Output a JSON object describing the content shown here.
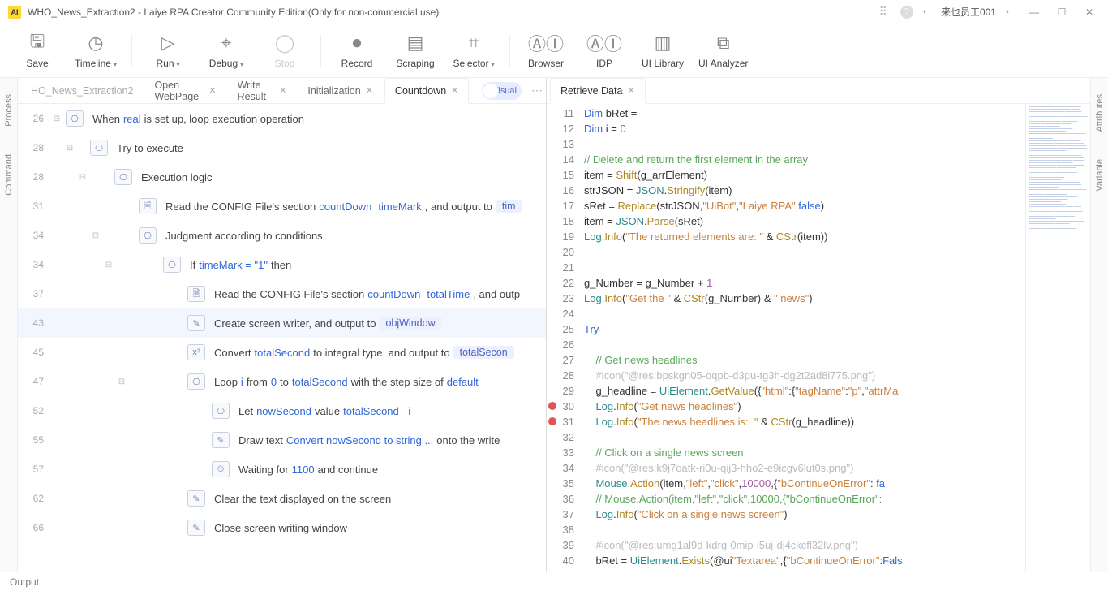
{
  "titlebar": {
    "title": "WHO_News_Extraction2 - Laiye RPA Creator Community Edition(Only for non-commercial use)",
    "user": "来也员工001"
  },
  "toolbar": {
    "save": "Save",
    "timeline": "Timeline",
    "run": "Run",
    "debug": "Debug",
    "stop": "Stop",
    "record": "Record",
    "scraping": "Scraping",
    "selector": "Selector",
    "browser": "Browser",
    "idp": "IDP",
    "uilib": "UI Library",
    "uian": "UI Analyzer"
  },
  "leftPanels": {
    "process": "Process",
    "command": "Command"
  },
  "rightPanels": {
    "attributes": "Attributes",
    "variable": "Variable"
  },
  "tabs": {
    "t0": "HO_News_Extraction2",
    "t1": "Open WebPage",
    "t2": "Write Result",
    "t3": "Initialization",
    "t4": "Countdown",
    "toggle": "Visual"
  },
  "rightTab": "Retrieve Data",
  "statusbar": {
    "output": "Output"
  },
  "flow": [
    {
      "ln": "26",
      "fold": true,
      "indent": 0,
      "icon": "⎔",
      "segs": [
        {
          "t": "When "
        },
        {
          "t": "real",
          "c": "kw"
        },
        {
          "t": " is set up, loop execution operation"
        }
      ]
    },
    {
      "ln": "28",
      "fold": true,
      "indent": 1,
      "icon": "⎔",
      "segs": [
        {
          "t": "Try to execute"
        }
      ]
    },
    {
      "ln": "28",
      "fold": true,
      "indent": 2,
      "icon": "⎔",
      "segs": [
        {
          "t": "Execution logic"
        }
      ]
    },
    {
      "ln": "31",
      "fold": false,
      "indent": 3,
      "icon": "🗎",
      "segs": [
        {
          "t": "Read the CONFIG File's section "
        },
        {
          "t": "countDown",
          "c": "kw"
        },
        {
          "t": "  "
        },
        {
          "t": "timeMark",
          "c": "kw"
        },
        {
          "t": " , and output to  "
        },
        {
          "t": "tim",
          "c": "chip"
        }
      ]
    },
    {
      "ln": "34",
      "fold": true,
      "indent": 3,
      "icon": "⎔",
      "segs": [
        {
          "t": "Judgment according to conditions"
        }
      ]
    },
    {
      "ln": "34",
      "fold": true,
      "indent": 4,
      "icon": "⎔",
      "segs": [
        {
          "t": "If "
        },
        {
          "t": "timeMark = \"1\"",
          "c": "kw"
        },
        {
          "t": " then"
        }
      ]
    },
    {
      "ln": "37",
      "fold": false,
      "indent": 5,
      "icon": "🗎",
      "segs": [
        {
          "t": "Read the CONFIG File's section "
        },
        {
          "t": "countDown",
          "c": "kw"
        },
        {
          "t": "  "
        },
        {
          "t": "totalTime",
          "c": "kw"
        },
        {
          "t": " , and outp"
        }
      ]
    },
    {
      "ln": "43",
      "fold": false,
      "indent": 5,
      "icon": "✎",
      "sel": true,
      "segs": [
        {
          "t": "Create screen writer, and output to  "
        },
        {
          "t": "objWindow",
          "c": "chip"
        }
      ]
    },
    {
      "ln": "45",
      "fold": false,
      "indent": 5,
      "icon": "x²",
      "segs": [
        {
          "t": "Convert "
        },
        {
          "t": "totalSecond",
          "c": "kw"
        },
        {
          "t": " to integral type, and output to  "
        },
        {
          "t": "totalSecon",
          "c": "chip"
        }
      ]
    },
    {
      "ln": "47",
      "fold": true,
      "indent": 5,
      "icon": "⎔",
      "segs": [
        {
          "t": "Loop "
        },
        {
          "t": "i",
          "c": "kw"
        },
        {
          "t": " from "
        },
        {
          "t": "0",
          "c": "kw"
        },
        {
          "t": " to "
        },
        {
          "t": "totalSecond",
          "c": "kw"
        },
        {
          "t": " with the step size of "
        },
        {
          "t": "default",
          "c": "kw"
        }
      ]
    },
    {
      "ln": "52",
      "fold": false,
      "indent": 6,
      "icon": "⎔",
      "segs": [
        {
          "t": "Let "
        },
        {
          "t": "nowSecond",
          "c": "kw"
        },
        {
          "t": " value "
        },
        {
          "t": "totalSecond - i",
          "c": "kw"
        }
      ]
    },
    {
      "ln": "55",
      "fold": false,
      "indent": 6,
      "icon": "✎",
      "segs": [
        {
          "t": "Draw text "
        },
        {
          "t": "Convert  nowSecond  to string ...",
          "c": "kw"
        },
        {
          "t": " onto the write"
        }
      ]
    },
    {
      "ln": "57",
      "fold": false,
      "indent": 6,
      "icon": "⏲",
      "segs": [
        {
          "t": "Waiting for "
        },
        {
          "t": "1100",
          "c": "kw"
        },
        {
          "t": " and continue"
        }
      ]
    },
    {
      "ln": "62",
      "fold": false,
      "indent": 5,
      "icon": "✎",
      "segs": [
        {
          "t": "Clear the text displayed on the screen"
        }
      ]
    },
    {
      "ln": "66",
      "fold": false,
      "indent": 5,
      "icon": "✎",
      "segs": [
        {
          "t": "Close screen writing window"
        }
      ]
    }
  ],
  "code": [
    {
      "n": 11,
      "h": "<span class='kw2'>Dim</span> bRet = "
    },
    {
      "n": 12,
      "h": "<span class='kw2'>Dim</span> i = <span class='num'>0</span>"
    },
    {
      "n": 13,
      "h": ""
    },
    {
      "n": 14,
      "h": "<span class='cmt'>// Delete and return the first element in the array</span>"
    },
    {
      "n": 15,
      "h": "item = <span class='fn'>Shift</span>(g_arrElement)"
    },
    {
      "n": 16,
      "h": "strJSON = <span class='typ'>JSON</span>.<span class='fn'>Stringify</span>(item)"
    },
    {
      "n": 17,
      "h": "sRet = <span class='fn'>Replace</span>(strJSON,<span class='str'>\"UiBot\"</span>,<span class='str'>\"Laiye RPA\"</span>,<span class='kw2'>false</span>)"
    },
    {
      "n": 18,
      "h": "item = <span class='typ'>JSON</span>.<span class='fn'>Parse</span>(sRet)"
    },
    {
      "n": 19,
      "h": "<span class='typ'>Log</span>.<span class='fn'>Info</span>(<span class='str'>\"The returned elements are: \"</span> &amp; <span class='fn'>CStr</span>(item))"
    },
    {
      "n": 20,
      "h": ""
    },
    {
      "n": 21,
      "h": ""
    },
    {
      "n": 22,
      "h": "g_Number = g_Number + <span class='num'>1</span>"
    },
    {
      "n": 23,
      "h": "<span class='typ'>Log</span>.<span class='fn'>Info</span>(<span class='str'>\"Get the \"</span> &amp; <span class='fn'>CStr</span>(g_Number) &amp; <span class='str'>\" news\"</span>)"
    },
    {
      "n": 24,
      "h": ""
    },
    {
      "n": 25,
      "h": "<span class='kw2'>Try</span>"
    },
    {
      "n": 26,
      "h": ""
    },
    {
      "n": 27,
      "h": "    <span class='cmt'>// Get news headlines</span>"
    },
    {
      "n": 28,
      "h": "    <span class='muted'>#icon(\"@res:bpskgn05-oqpb-d3pu-tg3h-dg2t2ad8i775.png\")</span>"
    },
    {
      "n": 29,
      "h": "    g_headline = <span class='typ'>UiElement</span>.<span class='fn'>GetValue</span>({<span class='str'>\"html\"</span>:{<span class='str'>\"tagName\"</span>:<span class='str'>\"p\"</span>,<span class='str'>\"attrMa</span>"
    },
    {
      "n": 30,
      "bp": true,
      "h": "    <span class='typ'>Log</span>.<span class='fn'>Info</span>(<span class='str'>\"Get news headlines\"</span>)"
    },
    {
      "n": 31,
      "bp": true,
      "h": "    <span class='typ'>Log</span>.<span class='fn'>Info</span>(<span class='str'>\"The news headlines is:  \"</span> &amp; <span class='fn'>CStr</span>(g_headline))"
    },
    {
      "n": 32,
      "h": ""
    },
    {
      "n": 33,
      "h": "    <span class='cmt'>// Click on a single news screen</span>"
    },
    {
      "n": 34,
      "h": "    <span class='muted'>#icon(\"@res:k9j7oatk-ri0u-qij3-hho2-e9icgv6lut0s.png\")</span>"
    },
    {
      "n": 35,
      "h": "    <span class='typ'>Mouse</span>.<span class='fn'>Action</span>(item,<span class='str'>\"left\"</span>,<span class='str'>\"click\"</span>,<span class='num'>10000</span>,{<span class='str'>\"bContinueOnError\"</span>: <span class='kw2'>fa</span>"
    },
    {
      "n": 36,
      "h": "    <span class='cmt'>// Mouse.Action(item,\"left\",\"click\",10000,{\"bContinueOnError\":</span>"
    },
    {
      "n": 37,
      "h": "    <span class='typ'>Log</span>.<span class='fn'>Info</span>(<span class='str'>\"Click on a single news screen\"</span>)"
    },
    {
      "n": 38,
      "h": ""
    },
    {
      "n": 39,
      "h": "    <span class='muted'>#icon(\"@res:umg1al9d-kdrg-0mip-i5uj-dj4ckcfl32lv.png\")</span>"
    },
    {
      "n": 40,
      "h": "    bRet = <span class='typ'>UiElement</span>.<span class='fn'>Exists</span>(@ui<span class='str'>\"Textarea\"</span>,{<span class='str'>\"bContinueOnError\"</span>:<span class='kw2'>Fals</span>"
    }
  ]
}
